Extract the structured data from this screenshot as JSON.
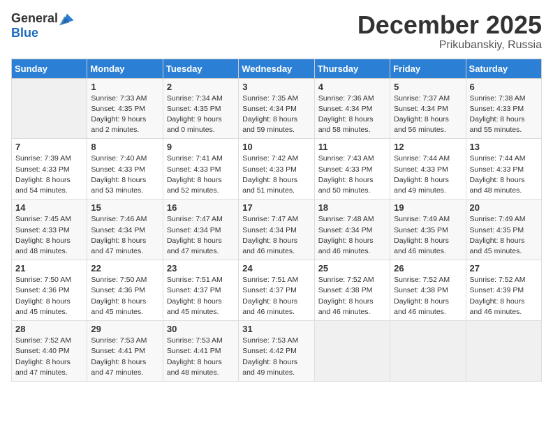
{
  "header": {
    "logo_general": "General",
    "logo_blue": "Blue",
    "month": "December 2025",
    "location": "Prikubanskiy, Russia"
  },
  "weekdays": [
    "Sunday",
    "Monday",
    "Tuesday",
    "Wednesday",
    "Thursday",
    "Friday",
    "Saturday"
  ],
  "weeks": [
    [
      {
        "day": "",
        "info": ""
      },
      {
        "day": "1",
        "info": "Sunrise: 7:33 AM\nSunset: 4:35 PM\nDaylight: 9 hours\nand 2 minutes."
      },
      {
        "day": "2",
        "info": "Sunrise: 7:34 AM\nSunset: 4:35 PM\nDaylight: 9 hours\nand 0 minutes."
      },
      {
        "day": "3",
        "info": "Sunrise: 7:35 AM\nSunset: 4:34 PM\nDaylight: 8 hours\nand 59 minutes."
      },
      {
        "day": "4",
        "info": "Sunrise: 7:36 AM\nSunset: 4:34 PM\nDaylight: 8 hours\nand 58 minutes."
      },
      {
        "day": "5",
        "info": "Sunrise: 7:37 AM\nSunset: 4:34 PM\nDaylight: 8 hours\nand 56 minutes."
      },
      {
        "day": "6",
        "info": "Sunrise: 7:38 AM\nSunset: 4:33 PM\nDaylight: 8 hours\nand 55 minutes."
      }
    ],
    [
      {
        "day": "7",
        "info": "Sunrise: 7:39 AM\nSunset: 4:33 PM\nDaylight: 8 hours\nand 54 minutes."
      },
      {
        "day": "8",
        "info": "Sunrise: 7:40 AM\nSunset: 4:33 PM\nDaylight: 8 hours\nand 53 minutes."
      },
      {
        "day": "9",
        "info": "Sunrise: 7:41 AM\nSunset: 4:33 PM\nDaylight: 8 hours\nand 52 minutes."
      },
      {
        "day": "10",
        "info": "Sunrise: 7:42 AM\nSunset: 4:33 PM\nDaylight: 8 hours\nand 51 minutes."
      },
      {
        "day": "11",
        "info": "Sunrise: 7:43 AM\nSunset: 4:33 PM\nDaylight: 8 hours\nand 50 minutes."
      },
      {
        "day": "12",
        "info": "Sunrise: 7:44 AM\nSunset: 4:33 PM\nDaylight: 8 hours\nand 49 minutes."
      },
      {
        "day": "13",
        "info": "Sunrise: 7:44 AM\nSunset: 4:33 PM\nDaylight: 8 hours\nand 48 minutes."
      }
    ],
    [
      {
        "day": "14",
        "info": "Sunrise: 7:45 AM\nSunset: 4:33 PM\nDaylight: 8 hours\nand 48 minutes."
      },
      {
        "day": "15",
        "info": "Sunrise: 7:46 AM\nSunset: 4:34 PM\nDaylight: 8 hours\nand 47 minutes."
      },
      {
        "day": "16",
        "info": "Sunrise: 7:47 AM\nSunset: 4:34 PM\nDaylight: 8 hours\nand 47 minutes."
      },
      {
        "day": "17",
        "info": "Sunrise: 7:47 AM\nSunset: 4:34 PM\nDaylight: 8 hours\nand 46 minutes."
      },
      {
        "day": "18",
        "info": "Sunrise: 7:48 AM\nSunset: 4:34 PM\nDaylight: 8 hours\nand 46 minutes."
      },
      {
        "day": "19",
        "info": "Sunrise: 7:49 AM\nSunset: 4:35 PM\nDaylight: 8 hours\nand 46 minutes."
      },
      {
        "day": "20",
        "info": "Sunrise: 7:49 AM\nSunset: 4:35 PM\nDaylight: 8 hours\nand 45 minutes."
      }
    ],
    [
      {
        "day": "21",
        "info": "Sunrise: 7:50 AM\nSunset: 4:36 PM\nDaylight: 8 hours\nand 45 minutes."
      },
      {
        "day": "22",
        "info": "Sunrise: 7:50 AM\nSunset: 4:36 PM\nDaylight: 8 hours\nand 45 minutes."
      },
      {
        "day": "23",
        "info": "Sunrise: 7:51 AM\nSunset: 4:37 PM\nDaylight: 8 hours\nand 45 minutes."
      },
      {
        "day": "24",
        "info": "Sunrise: 7:51 AM\nSunset: 4:37 PM\nDaylight: 8 hours\nand 46 minutes."
      },
      {
        "day": "25",
        "info": "Sunrise: 7:52 AM\nSunset: 4:38 PM\nDaylight: 8 hours\nand 46 minutes."
      },
      {
        "day": "26",
        "info": "Sunrise: 7:52 AM\nSunset: 4:38 PM\nDaylight: 8 hours\nand 46 minutes."
      },
      {
        "day": "27",
        "info": "Sunrise: 7:52 AM\nSunset: 4:39 PM\nDaylight: 8 hours\nand 46 minutes."
      }
    ],
    [
      {
        "day": "28",
        "info": "Sunrise: 7:52 AM\nSunset: 4:40 PM\nDaylight: 8 hours\nand 47 minutes."
      },
      {
        "day": "29",
        "info": "Sunrise: 7:53 AM\nSunset: 4:41 PM\nDaylight: 8 hours\nand 47 minutes."
      },
      {
        "day": "30",
        "info": "Sunrise: 7:53 AM\nSunset: 4:41 PM\nDaylight: 8 hours\nand 48 minutes."
      },
      {
        "day": "31",
        "info": "Sunrise: 7:53 AM\nSunset: 4:42 PM\nDaylight: 8 hours\nand 49 minutes."
      },
      {
        "day": "",
        "info": ""
      },
      {
        "day": "",
        "info": ""
      },
      {
        "day": "",
        "info": ""
      }
    ]
  ]
}
